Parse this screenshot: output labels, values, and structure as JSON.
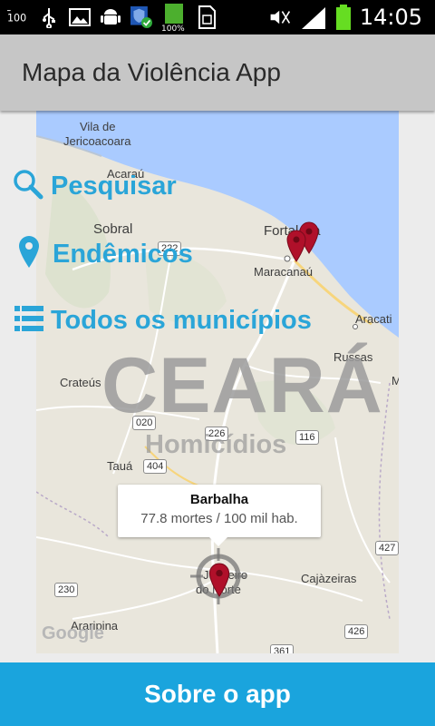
{
  "status_bar": {
    "time": "14:05",
    "battery_percent": 100,
    "battery_label": "100%",
    "icons": [
      "usb-connected-icon",
      "usb-icon",
      "gallery-icon",
      "android-icon",
      "shield-icon",
      "battery-status-icon",
      "sim-icon",
      "mute-icon",
      "signal-icon",
      "battery-icon"
    ]
  },
  "action_bar": {
    "title": "Mapa da Violência App"
  },
  "menu": {
    "search_label": "Pesquisar",
    "endemic_label": "Endêmicos",
    "all_label": "Todos os municípios",
    "icons": [
      "search-icon",
      "location-pin-icon",
      "list-icon"
    ]
  },
  "overlay": {
    "state": "CEARÁ",
    "subtitle": "Homicídios"
  },
  "map": {
    "places": {
      "vila": "Vila de",
      "jericoacoara": "Jericoacoara",
      "acarau": "Acaraú",
      "sobral": "Sobral",
      "fortaleza": "Fortaleza",
      "maracanau": "Maracanaú",
      "aracati": "Aracati",
      "russas": "Russas",
      "crateus": "Crateús",
      "taua": "Tauá",
      "cajazeiras": "Cajàzeiras",
      "juazeiro": "Juazeiro",
      "do_norte": "do Norte",
      "araripina": "Araripina",
      "m": "M"
    },
    "roads": {
      "r222": "222",
      "r020": "020",
      "r226": "226",
      "r116": "116",
      "r404": "404",
      "r427": "427",
      "r230": "230",
      "r426": "426",
      "r361": "361"
    },
    "attribution": "Google",
    "colors": {
      "water": "#aacbff",
      "land": "#e9e6dc",
      "marker": "#b0102a",
      "accent": "#2aa5d8"
    }
  },
  "info_window": {
    "title": "Barbalha",
    "text": "77.8 mortes / 100 mil hab."
  },
  "bottom_button": {
    "label": "Sobre o app"
  }
}
